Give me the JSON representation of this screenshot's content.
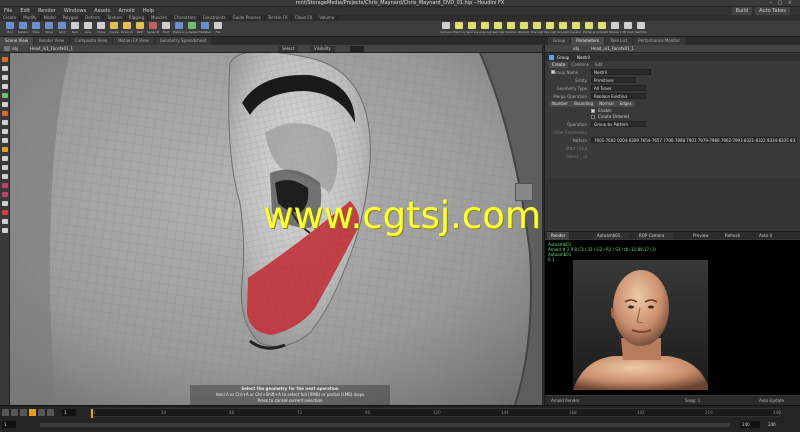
{
  "window": {
    "title": "mnt/StorageMedia/Projects/Chris_Maynard/Chris_Maynard_DVD_01.hip - Houdini FX",
    "controls": "– □ ×"
  },
  "menubar": {
    "items": [
      "File",
      "Edit",
      "Render",
      "Windows",
      "Assets",
      "Arnold",
      "Help"
    ],
    "right": [
      "Build",
      "Auto Takes"
    ]
  },
  "shelf_tabs": [
    "Create",
    "Modify",
    "Model",
    "Polygon",
    "Deform",
    "Texture",
    "Rigging",
    "Muscles",
    "Characters",
    "Constraints",
    "Guide Process",
    "Terrain FX",
    "Cloud FX",
    "Volume"
  ],
  "shelf_tools": [
    {
      "label": "Box",
      "color": "#6a8fd0"
    },
    {
      "label": "Sphere",
      "color": "#6a8fd0"
    },
    {
      "label": "Tube",
      "color": "#6a8fd0"
    },
    {
      "label": "Torus",
      "color": "#6a8fd0"
    },
    {
      "label": "Grid",
      "color": "#6a8fd0"
    },
    {
      "label": "Null",
      "color": "#cfcfcf"
    },
    {
      "label": "Line",
      "color": "#cfcfcf"
    },
    {
      "label": "Circle",
      "color": "#cfcfcf"
    },
    {
      "label": "Curve",
      "color": "#e0c050"
    },
    {
      "label": "Draw Curve",
      "color": "#e0c050"
    },
    {
      "label": "Path",
      "color": "#e0c050"
    },
    {
      "label": "Spray Paint",
      "color": "#c06060"
    },
    {
      "label": "Font",
      "color": "#cfcfcf"
    },
    {
      "label": "Platonic",
      "color": "#6a8fd0"
    },
    {
      "label": "L-System",
      "color": "#6fbf6f"
    },
    {
      "label": "Metaball",
      "color": "#6a8fd0"
    },
    {
      "label": "File",
      "color": "#cfcfcf"
    }
  ],
  "shelf_tools_right": [
    {
      "label": "Camera",
      "color": "#cfcfcf"
    },
    {
      "label": "Point Light",
      "color": "#e0e070"
    },
    {
      "label": "Spot Light",
      "color": "#e0e070"
    },
    {
      "label": "Area Light",
      "color": "#e0e070"
    },
    {
      "label": "Geo Light",
      "color": "#e0e070"
    },
    {
      "label": "Volume Light",
      "color": "#e0e070"
    },
    {
      "label": "Distant Light",
      "color": "#e0e070"
    },
    {
      "label": "Env Light",
      "color": "#e0e070"
    },
    {
      "label": "Sky Light",
      "color": "#e0e070"
    },
    {
      "label": "GI Light",
      "color": "#e0e070"
    },
    {
      "label": "Caustic Light",
      "color": "#e0e070"
    },
    {
      "label": "Portal Light",
      "color": "#e0e070"
    },
    {
      "label": "Ambient Light",
      "color": "#e0e070"
    },
    {
      "label": "Stereo Camera",
      "color": "#cfcfcf"
    },
    {
      "label": "VR Camera",
      "color": "#cfcfcf"
    },
    {
      "label": "Switcher",
      "color": "#cfcfcf"
    }
  ],
  "pane_tabs_left": [
    "Scene View",
    "Render View",
    "Composite View",
    "Motion FX View",
    "Geometry Spreadsheet"
  ],
  "pane_tabs_right": [
    "Group",
    "Parameters",
    "Take List",
    "Performance Monitor"
  ],
  "viewport": {
    "path_obj": "obj",
    "path_node": "Head_in1_Facefx01_1",
    "select_label": "Select",
    "visibility_label": "Visibility",
    "tool_label": "Group",
    "status_line1": "Select the geometry for the next operation",
    "status_line2": "Hold A or Ctrl+A or Ctrl+Shift+A to select full (RMB) or partial (LMB) loops",
    "status_line3": "Press   to cancel current selection"
  },
  "watermark": "www.cgtsj.com",
  "params": {
    "node_type": "Group",
    "node_name": "Nostril",
    "tabs": [
      "Create",
      "Combine",
      "Edit"
    ],
    "group_name_label": "Group Name",
    "group_name_value": "Nostril",
    "entity_label": "Entity",
    "entity_value": "Primitives",
    "geometry_type_label": "Geometry Type",
    "geometry_type_value": "All Types",
    "merge_op_label": "Merge Operation",
    "merge_op_value": "Replace Existing",
    "subtabs": [
      "Number",
      "Bounding",
      "Normal",
      "Edges"
    ],
    "enable_label": "Enable",
    "create_ordered_label": "Create Ordered",
    "operation_label": "Operation",
    "operation_value": "Group by Pattern",
    "filter_expression_label": "Filter Expression",
    "pattern_label": "Pattern",
    "pattern_value": "7601-7602 0204-0209 7654-7657 7706-7808 7901 7979-7980 7902-7993 8321-8322 8334-8335 8337-8338 8350",
    "start_end_label": "Start / End",
    "select_of_label": "Select _ of"
  },
  "render": {
    "tab_label": "Render",
    "renderer_value": "Autoamb01",
    "camera_value": "ROP Camera",
    "preview_label": "Preview",
    "refresh_label": "Refresh",
    "auto_update_label": "Auto U",
    "info_line1": "Autoamb01",
    "info_line2": "Arnold # 2 9 8  C3 / 33 / G2 / R2 / S3 / t0:-11:88.17 (1)",
    "info_line3": "Autoamb01",
    "info_line4": "0.1",
    "footer_left": "Arnold Render",
    "footer_snap": "Snap: 1",
    "footer_auto": "Auto Update"
  },
  "timeline": {
    "frame": "1",
    "start": "1",
    "end": "240",
    "ticks": [
      "1",
      "24",
      "48",
      "72",
      "96",
      "120",
      "144",
      "168",
      "192",
      "216",
      "240"
    ],
    "right_end": "240"
  }
}
